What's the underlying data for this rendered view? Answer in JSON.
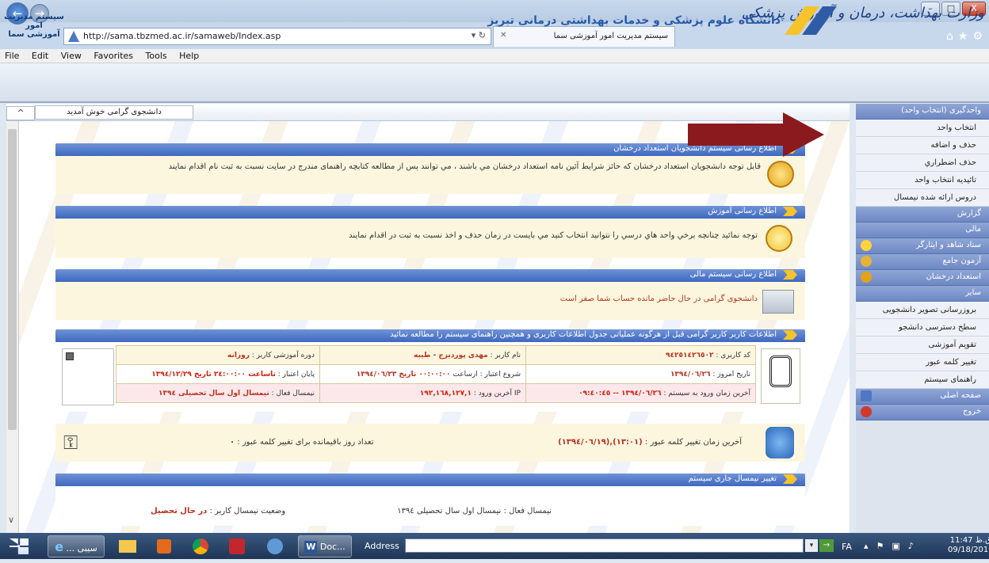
{
  "browser": {
    "url": "http://sama.tbzmed.ac.ir/samaweb/Index.asp",
    "tab_title": "سیستم مدیریت امور آموزشی سما",
    "window_buttons": [
      "–",
      "□",
      "X"
    ],
    "menu": [
      "File",
      "Edit",
      "View",
      "Favorites",
      "Tools",
      "Help"
    ]
  },
  "header": {
    "ministry": "وزارت بهداشت، درمان و آموزش پزشکی",
    "university": "دانشگاه علوم پزشکی و خدمات بهداشتی درمانی تبریز",
    "system_name_line1": "سیستم مدیریت امور",
    "system_name_line2": "آموزشی سما"
  },
  "welcome": "دانشجوی گرامی خوش آمدید",
  "panels": {
    "p1_title": "اطلاع رسانی سیستم دانشجویان استعداد درخشان",
    "p1_text": "قابل توجه دانشجویان استعداد درخشان که حائز شرایط آئین نامه استعداد درخشان مي باشند ، مي توانند پس از مطالعه کتابچه راهنمای مندرج در سایت نسبت به ثبت نام اقدام نمایند",
    "p2_title": "اطلاع رسانی آموزش",
    "p2_text": "توجه نمائید چنانچه برخي واحد هاي درسي را نتوانید انتخاب کنید مي بایست در زمان حذف و اخذ نسبت به ثبت در اقدام نمایند",
    "p3_title": "اطلاع رسانی سیستم مالی",
    "p3_text": "دانشجوی گرامی در حال حاضر مانده حساب شما صفر است",
    "p4_title": "اطلاعات کاربر کاربر گرامی قبل از هرگونه عملیاتی جدول اطلاعات کاربری و همچنین راهنمای سیستم را مطالعه نمائید",
    "p5_title": "تغییر نیمسال جاری سیستم"
  },
  "user_info": {
    "user_code_label": "کد کاربری :",
    "user_code": "۹٤۲٥۱٤۲٦٥۰۲",
    "user_name_label": "نام کاربر :",
    "user_name": "مهدی پوردیزج - طیبه",
    "period_label": "دوره آموزشی کاربر :",
    "period": "روزانه",
    "today_label": "تاریخ امروز :",
    "today": "۱۳۹٤/۰٦/۲٦",
    "validity_start_label": "شروع اعتبار : ازساعت",
    "validity_start": "۰۰:۰۰:۰۰ تاریخ ۱۳۹٤/۰٦/۲۳",
    "validity_end_label": "پایان اعتبار :",
    "validity_end": "تاساعت ۲٤:۰۰:۰۰ تاریخ ۱۳۹٤/۱۲/۲۹",
    "last_login_label": "آخرین زمان ورود به سیستم :",
    "last_login": "۱۳۹٤/۰٦/۲٦ -- ۰۹:٤۰:٤٥",
    "ip_label": "IP آخرین ورود :",
    "ip": "۱۹۲,۱٦۸,۱۲۷,۱",
    "semester_label": "نیمسال فعال :",
    "semester": "نیمسال اول سال تحصیلی ۱۳۹٤"
  },
  "password": {
    "last_change_label": "آخرین زمان تغییر کلمه عبور :",
    "last_change": "(۱۳:۰۱),(۱۳۹٤/۰٦/۱۹)",
    "days_label": "تعداد روز باقیمانده برای تغییر کلمه عبور :",
    "days": "۰"
  },
  "semester_change": {
    "active_label": "نیمسال فعال :",
    "active": "نیمسال اول سال تحصیلی ۱۳۹٤",
    "status_label": "وضعیت نیمسال کاربر :",
    "status": "در حال تحصیل"
  },
  "sidebar": {
    "unit_selection": "واحدگیری (انتخاب واحد)",
    "items1": [
      "انتخاب واحد",
      "حذف و اضافه",
      "حذف اضطراري",
      "تائیدیه انتخاب واحد",
      "دروس ارائه شده نیمسال"
    ],
    "report": "گزارش",
    "finance": "مالی",
    "staff": "ستاد شاهد و ایثارگر",
    "exam": "آزمون جامع",
    "talent": "استعداد درخشان",
    "other": "سایر",
    "items2": [
      "بروزرسانی تصویر دانشجویی",
      "سطح دسترسی دانشجو",
      "تقویم آموزشی",
      "تغییر کلمه عبور",
      "راهنمای سیستم"
    ],
    "home": "صفحه اصلی",
    "exit": "خروج"
  },
  "taskbar": {
    "ie_label": "... سیبی",
    "doc_label": "Doc...",
    "address_label": "Address",
    "lang": "FA",
    "time": "11:47 ق.ظ",
    "date": "09/18/2015"
  }
}
